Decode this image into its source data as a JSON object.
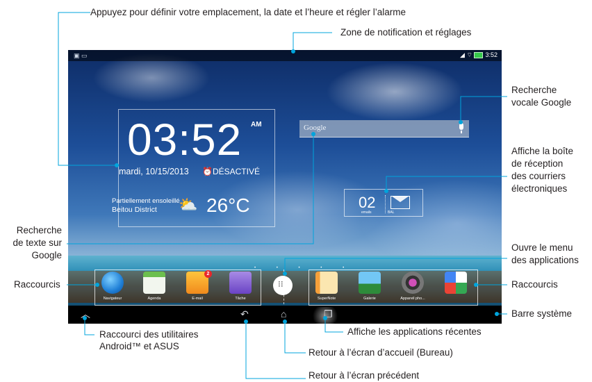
{
  "annotations": {
    "top_left": "Appuyez pour définir votre emplacement, la date et l’heure et régler l’alarme",
    "notif": "Zone de notification et réglages",
    "voice_line1": "Recherche",
    "voice_line2": "vocale Google",
    "inbox_line1": "Affiche la boîte",
    "inbox_line2": "de réception",
    "inbox_line3": "des courriers",
    "inbox_line4": "électroniques",
    "search_line1": "Recherche",
    "search_line2": "de texte sur",
    "search_line3": "Google",
    "apps_line1": "Ouvre le menu",
    "apps_line2": "des applications",
    "shortcuts_left": "Raccourcis",
    "shortcuts_right": "Raccourcis",
    "systembar": "Barre système",
    "utils_line1": "Raccourci des utilitaires",
    "utils_line2": "Android™ et ASUS",
    "recent": "Affiche les applications récentes",
    "home": "Retour à l’écran d’accueil (Bureau)",
    "back": "Retour à l’écran précédent"
  },
  "screen": {
    "status_time": "3:52",
    "clock_time": "03:52",
    "clock_ampm": "AM",
    "clock_date": "mardi, 10/15/2013",
    "clock_alarm": "⏰DÉSACTIVÉ",
    "weather_condition": "Partiellement ensoleillé",
    "weather_place": "Beitou District",
    "weather_temp": "26°C",
    "search_label": "Google",
    "mail_count": "02",
    "mail_label_emails": "emails",
    "mail_label_bal": "BAL",
    "dock_left": [
      {
        "label": "Navigateur",
        "icon": "globe-icon",
        "color": "#1f7fd6"
      },
      {
        "label": "Agenda",
        "icon": "calendar-icon",
        "color": "#e9efe3"
      },
      {
        "label": "E-mail",
        "icon": "mail-icon",
        "color": "#f4a21d",
        "badge": "2"
      },
      {
        "label": "Tâche",
        "icon": "task-icon",
        "color": "#8a63d2"
      }
    ],
    "dock_right": [
      {
        "label": "SuperNote",
        "icon": "notebook-icon",
        "color": "#f08a24"
      },
      {
        "label": "Galerie",
        "icon": "gallery-icon",
        "color": "#3aa0e6"
      },
      {
        "label": "Appareil pho...",
        "icon": "camera-icon",
        "color": "#4a4a55"
      },
      {
        "label": "",
        "icon": "google-folder-icon",
        "color": "#34a853"
      }
    ]
  },
  "colors": {
    "annotation_text": "#231f20",
    "leader_line": "#00a4dc",
    "navbar": "#000000"
  }
}
